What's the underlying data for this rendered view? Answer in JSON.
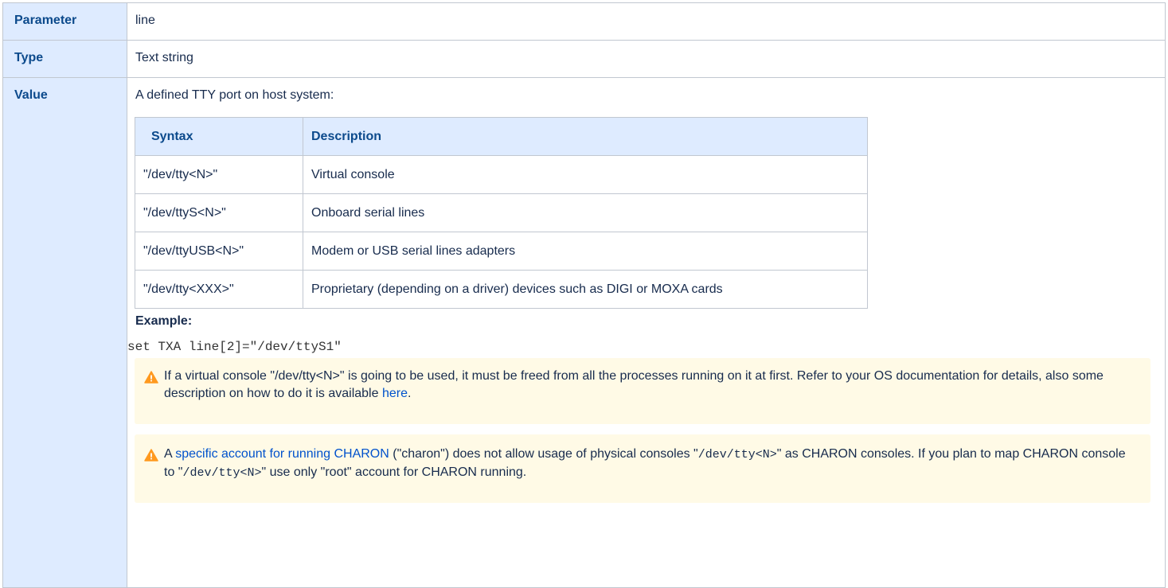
{
  "rows": {
    "parameter": {
      "label": "Parameter",
      "value": "line"
    },
    "type": {
      "label": "Type",
      "value": "Text string"
    },
    "value": {
      "label": "Value",
      "intro": "A defined TTY port on host system:"
    }
  },
  "syntax_table": {
    "headers": [
      "Syntax",
      "Description"
    ],
    "rows": [
      [
        "\"/dev/tty<N>\"",
        "Virtual console"
      ],
      [
        "\"/dev/ttyS<N>\"",
        "Onboard serial lines"
      ],
      [
        "\"/dev/ttyUSB<N>\"",
        "Modem or USB serial lines adapters"
      ],
      [
        "\"/dev/tty<XXX>\"",
        "Proprietary (depending on a driver) devices such as DIGI or MOXA cards"
      ]
    ]
  },
  "example": {
    "label": "Example:",
    "code": "set TXA line[2]=\"/dev/ttyS1\""
  },
  "warnings": {
    "first": {
      "text": "If a virtual console \"/dev/tty<N>\" is going to be used, it must be freed from all the processes running on it at first. Refer to your OS documentation for details, also some description on how to do it is available ",
      "link": "here",
      "tail": "."
    },
    "second": {
      "pre": "A ",
      "link": "specific account for running CHARON",
      "mid1": " (\"charon\") does not allow usage of physical consoles \"",
      "code1": "/dev/tty<N>",
      "mid2": "\" as CHARON consoles. If you plan to map CHARON console to \"",
      "code2": "/dev/tty<N>",
      "tail": "\" use only \"root\" account for CHARON running."
    }
  },
  "colors": {
    "header_bg": "#deebff",
    "header_text": "#0c4a8c",
    "warning_bg": "#fffae6",
    "warning_icon": "#ff991f",
    "link": "#0052cc"
  },
  "icons": {
    "warning": "warning-triangle-icon"
  }
}
